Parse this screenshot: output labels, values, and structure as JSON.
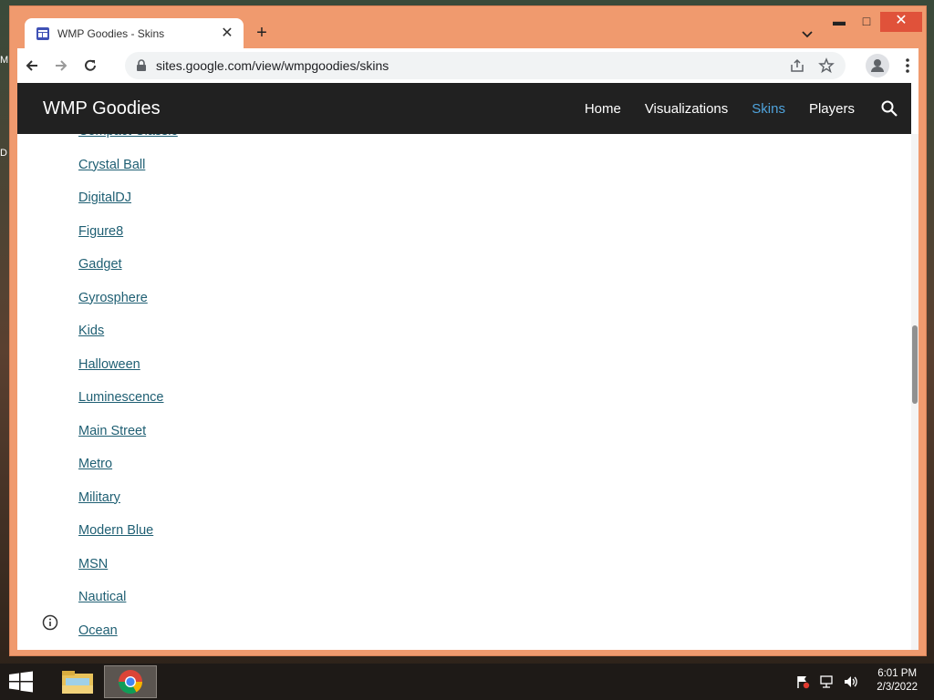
{
  "browser": {
    "tab_title": "WMP Goodies - Skins",
    "url": "sites.google.com/view/wmpgoodies/skins"
  },
  "site": {
    "title": "WMP Goodies",
    "nav": [
      {
        "label": "Home"
      },
      {
        "label": "Visualizations"
      },
      {
        "label": "Skins"
      },
      {
        "label": "Players"
      }
    ],
    "active_nav": "Skins",
    "accent_color": "#4fa3dc",
    "header_color": "#212121",
    "link_color": "#1f5f73"
  },
  "skins": [
    "Compact Classic",
    "Crystal Ball",
    "DigitalDJ",
    "Figure8",
    "Gadget",
    "Gyrosphere",
    "Kids",
    "Halloween",
    "Luminescence",
    "Main Street",
    "Metro",
    "Military",
    "Modern Blue",
    "MSN",
    "Nautical",
    "Ocean"
  ],
  "taskbar": {
    "time": "6:01 PM",
    "date": "2/3/2022",
    "apps": [
      "file-explorer-icon",
      "chrome-icon"
    ]
  },
  "desktop": {
    "stub_1": "M",
    "stub_2": "D"
  }
}
